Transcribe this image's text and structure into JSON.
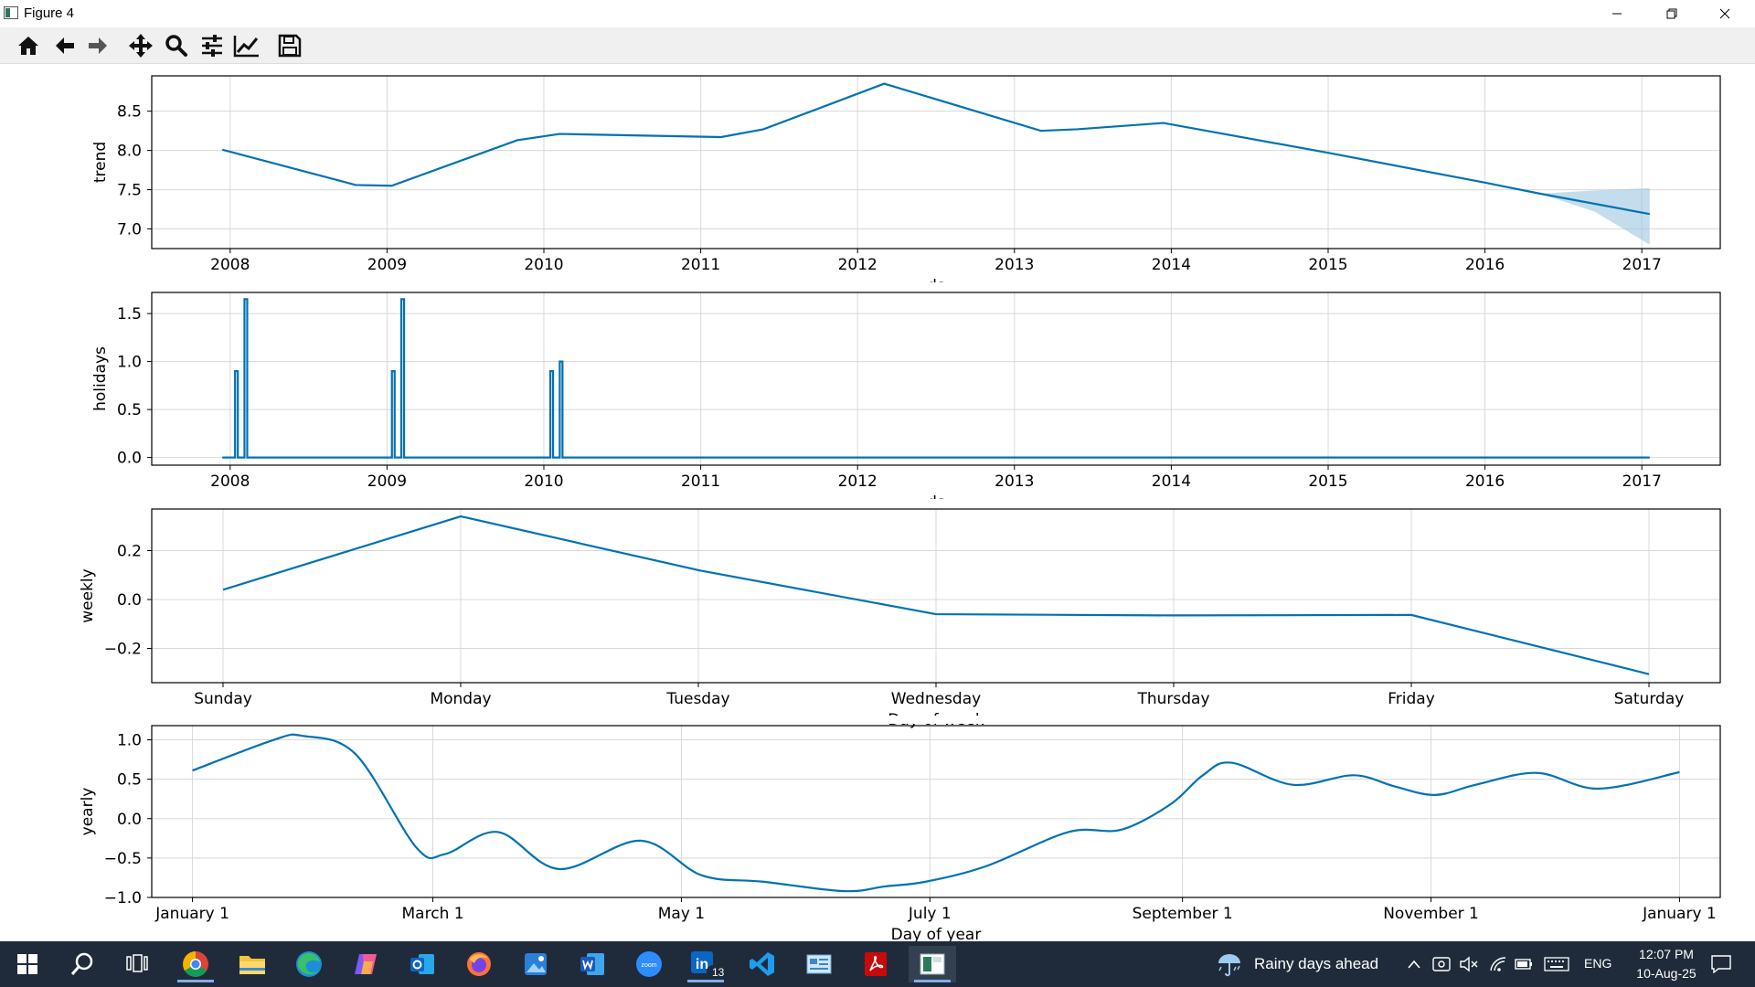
{
  "window": {
    "title": "Figure 4"
  },
  "toolbar": {
    "buttons": [
      {
        "icon": "home-icon"
      },
      {
        "icon": "back-arrow-icon"
      },
      {
        "icon": "forward-arrow-icon"
      },
      {
        "icon": "pan-move-icon"
      },
      {
        "icon": "zoom-magnifier-icon"
      },
      {
        "icon": "configure-subplots-icon"
      },
      {
        "icon": "edit-axis-icon"
      },
      {
        "icon": "save-floppy-icon"
      }
    ]
  },
  "colors": {
    "line": "#0072B2",
    "band": "#9dc6e0",
    "grid": "#d8d8d8",
    "taskbar": "#1f2b3a"
  },
  "chart_data": [
    {
      "type": "line",
      "ylabel": "trend",
      "xlabel": "ds",
      "x_ticks": [
        "2008",
        "2009",
        "2010",
        "2011",
        "2012",
        "2013",
        "2014",
        "2015",
        "2016",
        "2017"
      ],
      "x": [
        2007.95,
        2008.8,
        2009.03,
        2009.83,
        2010.1,
        2011.13,
        2011.4,
        2012.17,
        2013.17,
        2013.4,
        2013.95,
        2015.0,
        2016.0,
        2016.35,
        2017.05
      ],
      "y": [
        8.01,
        7.56,
        7.55,
        8.13,
        8.21,
        8.17,
        8.27,
        8.85,
        8.25,
        8.27,
        8.35,
        7.97,
        7.59,
        7.45,
        7.19
      ],
      "band_x": [
        2016.35,
        2016.7,
        2017.05
      ],
      "band_lower": [
        7.45,
        7.22,
        6.8
      ],
      "band_upper": [
        7.45,
        7.49,
        7.52
      ],
      "xlim": [
        2007.5,
        2017.5
      ],
      "ylim": [
        6.75,
        8.95
      ],
      "y_ticks": [
        "7.0",
        "7.5",
        "8.0",
        "8.5"
      ],
      "y_tick_values": [
        7.0,
        7.5,
        8.0,
        8.5
      ]
    },
    {
      "type": "line",
      "ylabel": "holidays",
      "xlabel": "ds",
      "x_ticks": [
        "2008",
        "2009",
        "2010",
        "2011",
        "2012",
        "2013",
        "2014",
        "2015",
        "2016",
        "2017"
      ],
      "baseline_range": [
        2007.95,
        2017.05
      ],
      "spikes": [
        {
          "x": 2008.04,
          "y": 0.9
        },
        {
          "x": 2008.1,
          "y": 1.65
        },
        {
          "x": 2009.04,
          "y": 0.9
        },
        {
          "x": 2009.1,
          "y": 1.65
        },
        {
          "x": 2010.05,
          "y": 0.9
        },
        {
          "x": 2010.11,
          "y": 1.0
        }
      ],
      "xlim": [
        2007.5,
        2017.5
      ],
      "ylim": [
        -0.08,
        1.72
      ],
      "y_ticks": [
        "0.0",
        "0.5",
        "1.0",
        "1.5"
      ],
      "y_tick_values": [
        0.0,
        0.5,
        1.0,
        1.5
      ]
    },
    {
      "type": "line",
      "ylabel": "weekly",
      "xlabel": "Day of week",
      "categories": [
        "Sunday",
        "Monday",
        "Tuesday",
        "Wednesday",
        "Thursday",
        "Friday",
        "Saturday"
      ],
      "values": [
        0.04,
        0.34,
        0.12,
        -0.06,
        -0.065,
        -0.063,
        -0.305
      ],
      "ylim": [
        -0.34,
        0.37
      ],
      "y_ticks": [
        "0.2",
        "0.0",
        "−0.2"
      ],
      "y_tick_values": [
        0.2,
        0.0,
        -0.2
      ]
    },
    {
      "type": "line",
      "ylabel": "yearly",
      "xlabel": "Day of year",
      "x_ticks": [
        "January 1",
        "March 1",
        "May 1",
        "July 1",
        "September 1",
        "November 1",
        "January 1"
      ],
      "x_tick_days": [
        0,
        59,
        120,
        181,
        243,
        304,
        365
      ],
      "x": [
        0,
        20,
        27,
        40,
        55,
        62,
        75,
        90,
        110,
        125,
        140,
        160,
        170,
        180,
        195,
        215,
        228,
        240,
        248,
        255,
        270,
        285,
        295,
        305,
        315,
        330,
        345,
        365
      ],
      "y": [
        0.61,
        1.0,
        1.05,
        0.82,
        -0.37,
        -0.45,
        -0.17,
        -0.64,
        -0.28,
        -0.72,
        -0.8,
        -0.92,
        -0.86,
        -0.8,
        -0.6,
        -0.17,
        -0.14,
        0.18,
        0.55,
        0.71,
        0.43,
        0.55,
        0.41,
        0.3,
        0.43,
        0.58,
        0.38,
        0.59
      ],
      "xlim": [
        -10,
        375
      ],
      "ylim": [
        -1.0,
        1.18
      ],
      "y_ticks": [
        "1.0",
        "0.5",
        "0.0",
        "−0.5",
        "−1.0"
      ],
      "y_tick_values": [
        1.0,
        0.5,
        0.0,
        -0.5,
        -1.0
      ]
    }
  ],
  "taskbar": {
    "weather_text": "Rainy days ahead",
    "language": "ENG",
    "time": "12:07 PM",
    "date": "10-Aug-25",
    "linkedin_badge": "13"
  }
}
